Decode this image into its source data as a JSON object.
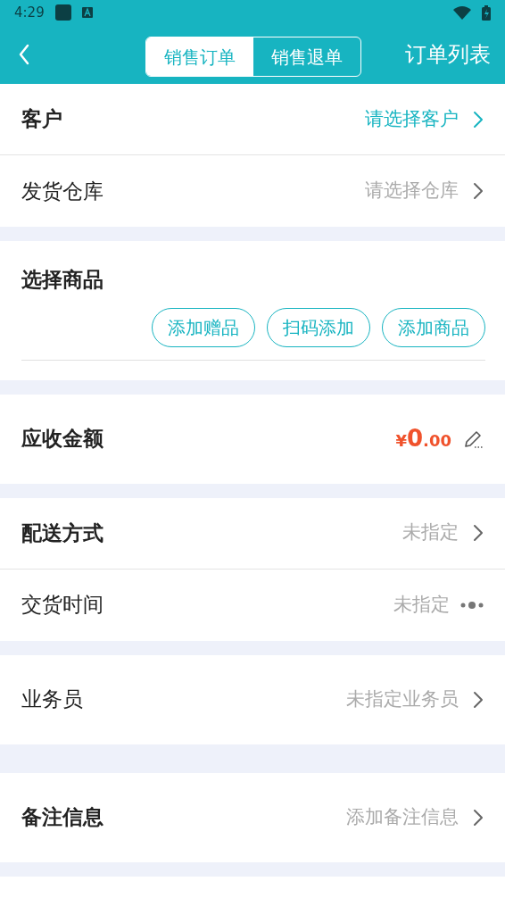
{
  "status_bar": {
    "time": "4:29"
  },
  "header": {
    "tabs": [
      {
        "label": "销售订单",
        "selected": true
      },
      {
        "label": "销售退单",
        "selected": false
      }
    ],
    "action": "订单列表"
  },
  "sections": [
    {
      "kind": "rows",
      "rows": [
        {
          "kind": "link",
          "label": "客户",
          "bold": true,
          "value": "请选择客户",
          "highlight": true
        },
        {
          "kind": "link",
          "label": "发货仓库",
          "bold": false,
          "value": "请选择仓库",
          "highlight": false
        }
      ]
    },
    {
      "kind": "goods",
      "title": "选择商品",
      "buttons": [
        "添加赠品",
        "扫码添加",
        "添加商品"
      ]
    },
    {
      "kind": "amount",
      "label": "应收金额",
      "currency": "¥",
      "integer": "0",
      "decimal": ".00"
    },
    {
      "kind": "rows",
      "rows": [
        {
          "kind": "link",
          "label": "配送方式",
          "bold": true,
          "value": "未指定",
          "highlight": false
        },
        {
          "kind": "more",
          "label": "交货时间",
          "bold": false,
          "value": "未指定",
          "highlight": false
        }
      ]
    },
    {
      "kind": "rows",
      "rows": [
        {
          "kind": "link",
          "label": "业务员",
          "bold": false,
          "value": "未指定业务员",
          "highlight": false
        }
      ]
    },
    {
      "kind": "rows",
      "rows": [
        {
          "kind": "link",
          "label": "备注信息",
          "bold": true,
          "value": "添加备注信息",
          "highlight": false
        }
      ]
    }
  ]
}
